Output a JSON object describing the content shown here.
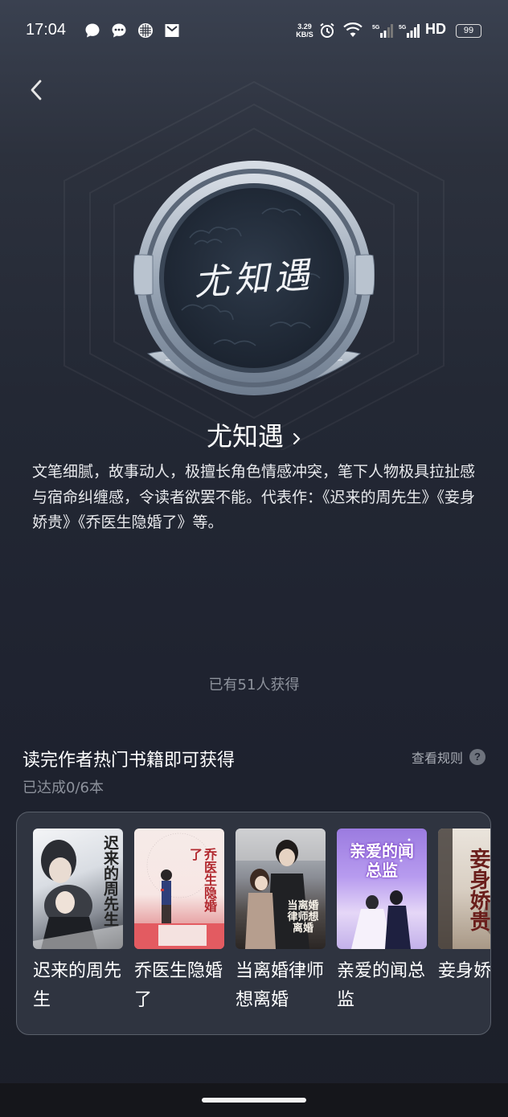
{
  "status_bar": {
    "time": "17:04",
    "net_speed_value": "3.29",
    "net_speed_unit": "KB/S",
    "signal_1_label": "5G",
    "signal_2_label": "5G",
    "hd_label": "HD",
    "battery": "99",
    "icons": [
      "chat-bubble-icon",
      "message-dots-icon",
      "network-grid-icon",
      "mail-icon",
      "alarm-icon",
      "wifi-icon",
      "signal-icon",
      "signal-icon"
    ]
  },
  "header": {
    "back_icon": "chevron-left-icon"
  },
  "badge": {
    "signature_text": "尤知遇",
    "icon": "author-medal-badge"
  },
  "author": {
    "name": "尤知遇",
    "description": "文笔细腻，故事动人，极擅长角色情感冲突，笔下人物极具拉扯感与宿命纠缠感，令读者欲罢不能。代表作：《迟来的周先生》《妾身娇贵》《乔医生隐婚了》等。"
  },
  "earned_count": "已有51人获得",
  "task": {
    "title": "读完作者热门书籍即可获得",
    "rules_label": "查看规则",
    "progress": "已达成0/6本"
  },
  "books": [
    {
      "title": "迟来的周先生",
      "cover_text": "迟来的周先生"
    },
    {
      "title": "乔医生隐婚了",
      "cover_text": "乔医生隐婚了"
    },
    {
      "title": "当离婚律师想离婚",
      "cover_text": "当离婚律师想离婚"
    },
    {
      "title": "亲爱的闻总监",
      "cover_text": "亲爱的闻总监"
    },
    {
      "title": "妾身娇贵",
      "cover_text": "妾身娇贵"
    }
  ],
  "colors": {
    "background": "#1f2330",
    "card_bg": "#2f3440",
    "card_border": "#5a606b",
    "primary_text": "#ffffff",
    "secondary_text": "#8d929c"
  }
}
